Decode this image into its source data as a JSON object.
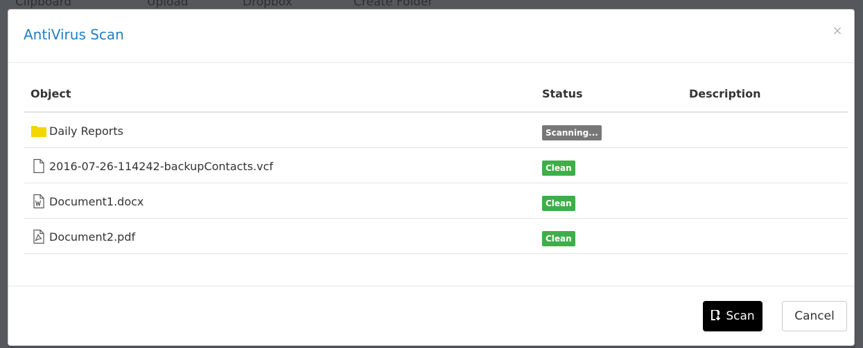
{
  "background_toolbar": [
    "Clipboard",
    "Upload",
    "Dropbox",
    "Create Folder"
  ],
  "modal": {
    "title": "AntiVirus Scan",
    "close_label": "×"
  },
  "table": {
    "headers": {
      "object": "Object",
      "status": "Status",
      "description": "Description"
    },
    "rows": [
      {
        "icon": "folder-icon",
        "name": "Daily Reports",
        "status": "Scanning...",
        "status_kind": "scanning",
        "description": ""
      },
      {
        "icon": "file-icon",
        "name": "2016-07-26-114242-backupContacts.vcf",
        "status": "Clean",
        "status_kind": "clean",
        "description": ""
      },
      {
        "icon": "word-document-icon",
        "name": "Document1.docx",
        "status": "Clean",
        "status_kind": "clean",
        "description": ""
      },
      {
        "icon": "pdf-document-icon",
        "name": "Document2.pdf",
        "status": "Clean",
        "status_kind": "clean",
        "description": ""
      }
    ]
  },
  "footer": {
    "scan_label": "Scan",
    "cancel_label": "Cancel"
  },
  "colors": {
    "title": "#1e7fc6",
    "folder": "#f2d600",
    "scanning_badge": "#777777",
    "clean_badge": "#3fae49",
    "scan_button": "#000000"
  }
}
